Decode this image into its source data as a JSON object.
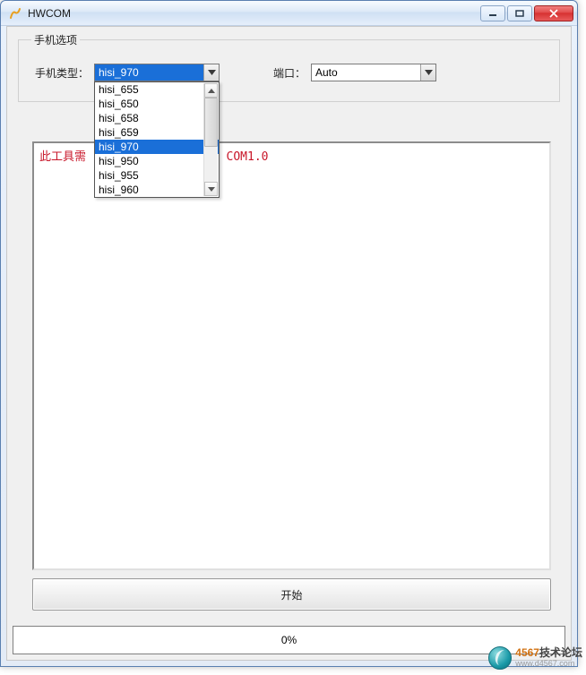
{
  "window": {
    "title": "HWCOM"
  },
  "fieldset": {
    "legend": "手机选项",
    "phone_type_label": "手机类型：",
    "port_label": "端口：",
    "phone_type_value": "hisi_970",
    "port_value": "Auto",
    "dropdown_options": [
      "hisi_655",
      "hisi_650",
      "hisi_658",
      "hisi_659",
      "hisi_970",
      "hisi_950",
      "hisi_955",
      "hisi_960"
    ],
    "dropdown_selected_index": 4
  },
  "message": "此工具需                    COM1.0",
  "start_button": "开始",
  "progress_text": "0%",
  "watermark": {
    "brand_num": "4567",
    "brand_txt": "技术论坛",
    "url": "www.d4567.com"
  }
}
